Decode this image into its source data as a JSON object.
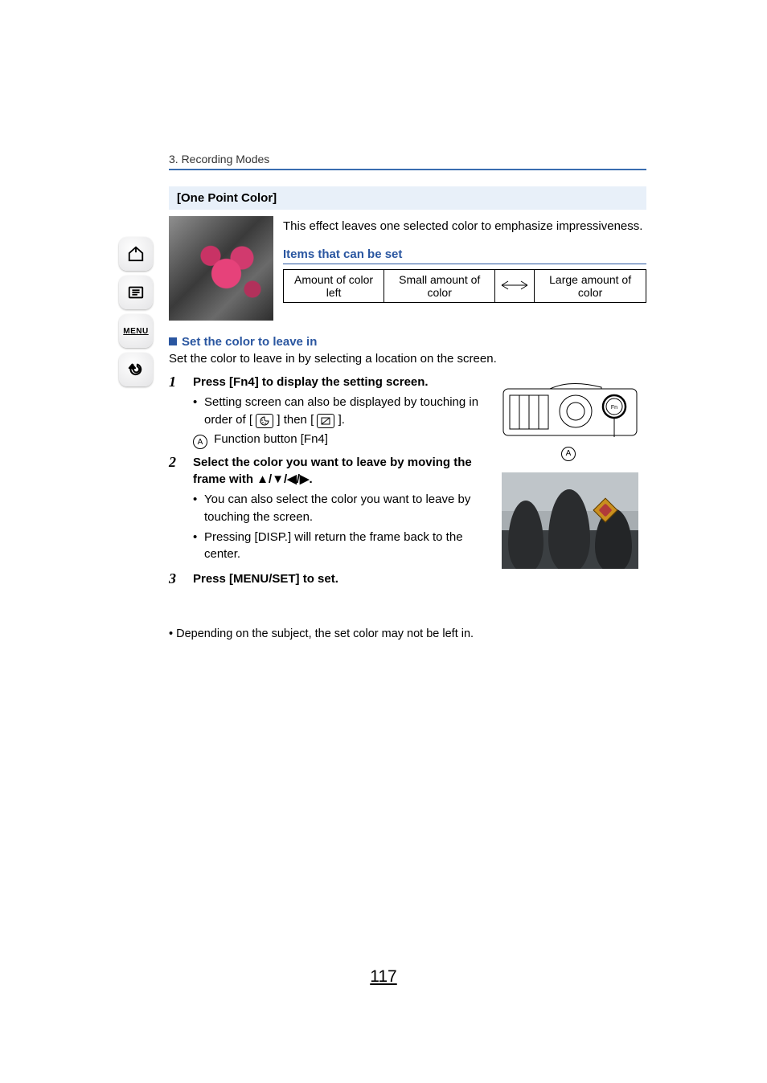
{
  "breadcrumb": "3. Recording Modes",
  "section": {
    "title": "[One Point Color]"
  },
  "intro": {
    "description": "This effect leaves one selected color to emphasize impressiveness.",
    "items_heading": "Items that can be set"
  },
  "table": {
    "param": "Amount of color left",
    "low": "Small amount of color",
    "high": "Large amount of color"
  },
  "subsection": {
    "heading": "Set the color to leave in",
    "description": "Set the color to leave in by selecting a location on the screen."
  },
  "steps": [
    {
      "num": "1",
      "title": "Press [Fn4] to display the setting screen.",
      "bullets": [
        "Setting screen can also be displayed by touching in order of [",
        "Function button [Fn4]"
      ],
      "then_text": "] then [",
      "end_text": "].",
      "annotation_letter": "A"
    },
    {
      "num": "2",
      "title": "Select the color you want to leave by moving the frame with ▲/▼/◀/▶.",
      "bullets": [
        "You can also select the color you want to leave by touching the screen.",
        "Pressing [DISP.] will return the frame back to the center."
      ]
    },
    {
      "num": "3",
      "title": "Press [MENU/SET] to set."
    }
  ],
  "figure_label": "A",
  "footnote": "Depending on the subject, the set color may not be left in.",
  "page_number": "117",
  "sidebar": {
    "home": "home",
    "toc": "toc",
    "menu": "MENU",
    "back": "back"
  },
  "icons": {
    "palette": "palette-icon",
    "adjust": "adjust-icon",
    "fn_button": "Fn"
  }
}
